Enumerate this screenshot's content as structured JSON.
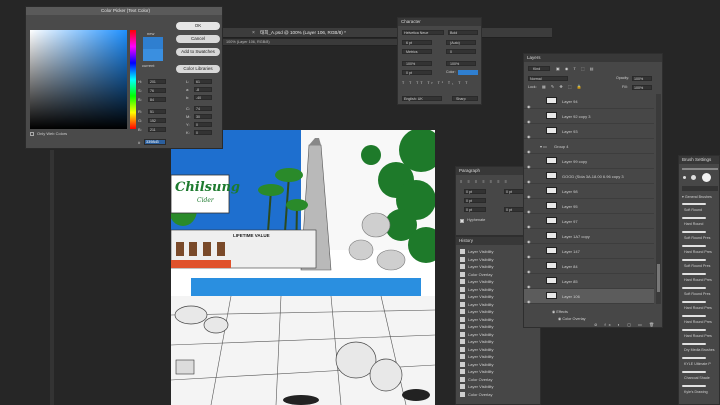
{
  "document": {
    "tab_title": "태희_A.psd @ 100% (Layer 106, RGB/8) *",
    "ruler_label": "100% (Layer 106, RGB/8)"
  },
  "color_picker": {
    "title": "Color Picker (Text Color)",
    "ok_label": "OK",
    "cancel_label": "Cancel",
    "add_swatches_label": "Add to Swatches",
    "color_libraries_label": "Color Libraries",
    "new_label": "new",
    "current_label": "current",
    "only_web_colors_label": "Only Web Colors",
    "new_color": "#2f7fd0",
    "current_color": "#3a8fe0",
    "fields": [
      {
        "label": "H:",
        "value": "201"
      },
      {
        "label": "S:",
        "value": "76"
      },
      {
        "label": "B:",
        "value": "84"
      },
      {
        "label": "R:",
        "value": "51"
      },
      {
        "label": "G:",
        "value": "152"
      },
      {
        "label": "B:",
        "value": "211"
      }
    ],
    "lab_fields": [
      {
        "label": "L:",
        "value": "61"
      },
      {
        "label": "a:",
        "value": "-8"
      },
      {
        "label": "b:",
        "value": "-40"
      },
      {
        "label": "C:",
        "value": "74"
      },
      {
        "label": "M:",
        "value": "30"
      },
      {
        "label": "Y:",
        "value": "0"
      },
      {
        "label": "K:",
        "value": "0"
      }
    ],
    "hex": "3398d3"
  },
  "character": {
    "title": "Character",
    "font_family": "Helvetica Neue",
    "font_style": "Bold",
    "size_field": "6 pt",
    "leading_field": "(Auto)",
    "tracking_field": "Metrics",
    "kerning_field": "0",
    "vscale": "100%",
    "hscale": "100%",
    "baseline": "0 pt",
    "color_label": "Color:",
    "language": "English: UK",
    "antialias": "Sharp",
    "swatch_color": "#2f7fd0"
  },
  "paragraph": {
    "title": "Paragraph",
    "hyphenate_label": "Hyphenate",
    "fields": [
      "0 pt",
      "0 pt",
      "0 pt",
      "0 pt",
      "0 pt"
    ]
  },
  "history": {
    "title": "History",
    "items": [
      "Layer Visibility",
      "Layer Visibility",
      "Layer Visibility",
      "Color Overlay",
      "Layer Visibility",
      "Layer Visibility",
      "Layer Visibility",
      "Layer Visibility",
      "Layer Visibility",
      "Layer Visibility",
      "Layer Visibility",
      "Layer Visibility",
      "Layer Visibility",
      "Layer Visibility",
      "Layer Visibility",
      "Layer Visibility",
      "Layer Visibility",
      "Color Overlay",
      "Layer Visibility",
      "Color Overlay"
    ]
  },
  "layers": {
    "title": "Layers",
    "kind_label": "Kind",
    "blend_mode": "Normal",
    "opacity_label": "Opacity:",
    "opacity_value": "100%",
    "lock_label": "Lock:",
    "fill_label": "Fill:",
    "fill_value": "100%",
    "items": [
      {
        "name": "Layer 94"
      },
      {
        "name": "Layer 92 copy 3"
      },
      {
        "name": "Layer 93"
      },
      {
        "name": "Group 4"
      },
      {
        "name": "Layer 99 copy"
      },
      {
        "name": "GOOD (Sida 3A.18.00 6.96 copy 3"
      },
      {
        "name": "Layer 98"
      },
      {
        "name": "Layer 95"
      },
      {
        "name": "Layer 97"
      },
      {
        "name": "Layer 1A7 copy"
      },
      {
        "name": "Layer 147"
      },
      {
        "name": "Layer 84"
      },
      {
        "name": "Layer 85"
      },
      {
        "name": "Layer 106"
      }
    ],
    "effects_label": "Effects",
    "color_overlay_label": "Color Overlay"
  },
  "brushes": {
    "title": "Brush Settings",
    "general_label": "General Brushes",
    "items": [
      "Soft Round",
      "Hard Round",
      "Soft Round Pres",
      "Hard Round Pres",
      "Soft Round Pres",
      "Hard Round Pres",
      "Soft Round Pres",
      "Hard Round Pres",
      "Hard Round Pres",
      "Hard Round Pres",
      "Dry Media Brushes",
      "KYLE Ultimate P",
      "Charcoal Shade",
      "Kyle's Drawing"
    ]
  },
  "artwork": {
    "sign_text": "Chilsung",
    "sign_subtext": "Cider",
    "building_text": "LIFETIME VALUE"
  }
}
